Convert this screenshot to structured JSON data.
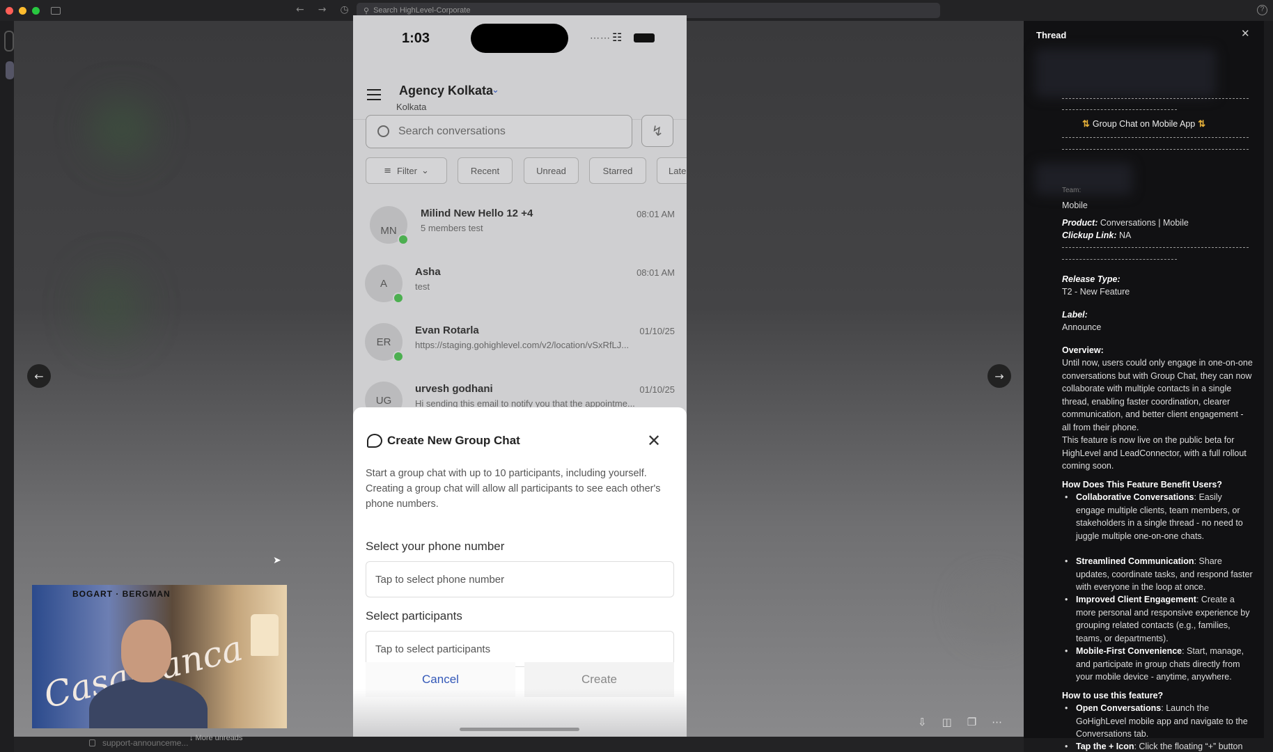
{
  "app": {
    "search_placeholder": "Search HighLevel-Corporate"
  },
  "phone": {
    "time": "1:03",
    "agency_name": "Agency Kolkata",
    "agency_location": "Kolkata",
    "search_placeholder": "Search conversations",
    "filters": [
      "Filter",
      "Recent",
      "Unread",
      "Starred",
      "Late"
    ],
    "conversations": [
      {
        "initials": "MN",
        "name": "Milind New Hello 12 +4",
        "preview": "5 members test",
        "time": "08:01 AM"
      },
      {
        "initials": "A",
        "name": "Asha",
        "preview": "test",
        "time": "08:01 AM"
      },
      {
        "initials": "ER",
        "name": "Evan Rotarla",
        "preview": "https://staging.gohighlevel.com/v2/location/vSxRfLJ...",
        "time": "01/10/25"
      },
      {
        "initials": "UG",
        "name": "urvesh godhani",
        "preview": "Hi sending this email to notify you that the appointme...",
        "time": "01/10/25"
      }
    ]
  },
  "modal": {
    "title": "Create New Group Chat",
    "description": "Start a group chat with up to 10 participants, including yourself. Creating a group chat will allow all participants to see each other's phone numbers.",
    "phone_label": "Select your phone number",
    "phone_placeholder": "Tap to select phone number",
    "participants_label": "Select participants",
    "participants_placeholder": "Tap to select participants",
    "cancel": "Cancel",
    "create": "Create"
  },
  "bottom": {
    "channel": "support-announceme...",
    "more_unreads": "↓ More unreads"
  },
  "thread": {
    "title": "Thread",
    "headline": "Group Chat on Mobile App",
    "team_label": "Team:",
    "team_value": "Mobile",
    "product_label": "Product:",
    "product_value": "Conversations | Mobile",
    "clickup_label": "Clickup Link:",
    "clickup_value": "NA",
    "release_label": "Release Type:",
    "release_value": "T2 - New Feature",
    "label_label": "Label:",
    "label_value": "Announce",
    "overview_label": "Overview:",
    "overview_p1": "Until now, users could only engage in one-on-one conversations but with Group Chat, they can now collaborate with multiple contacts in a single thread, enabling faster coordination, clearer communication, and better client engagement - all from their phone.",
    "overview_p2": "This feature is now live on the public beta for HighLevel and LeadConnector, with a full rollout coming soon.",
    "benefit_heading": "How Does This Feature Benefit Users?",
    "benefits": [
      {
        "title": "Collaborative Conversations",
        "text": ": Easily engage multiple clients, team members, or stakeholders in a single thread - no need to juggle multiple one-on-one chats."
      },
      {
        "title": "Streamlined Communication",
        "text": ": Share updates, coordinate tasks, and respond faster with everyone in the loop at once."
      },
      {
        "title": "Improved Client Engagement",
        "text": ": Create a more personal and responsive experience by grouping related contacts (e.g., families, teams, or departments)."
      },
      {
        "title": "Mobile-First Convenience",
        "text": ": Start, manage, and participate in group chats directly from your mobile device - anytime, anywhere."
      }
    ],
    "howto_heading": "How to use this feature?",
    "howto": [
      {
        "title": "Open Conversations",
        "text": ": Launch the GoHighLevel mobile app and navigate to the Conversations tab."
      },
      {
        "title": "Tap the + Icon",
        "text": ": Click the floating “+” button"
      }
    ]
  },
  "colors": {
    "accent": "#3358b8",
    "online": "#4caf50",
    "panel_bg": "#111113"
  }
}
